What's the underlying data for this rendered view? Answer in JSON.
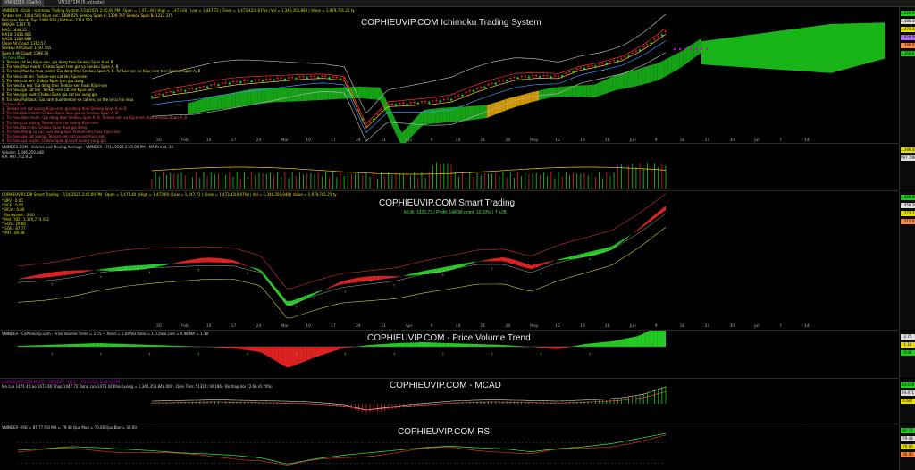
{
  "tabs": [
    "VNINDEX (Daily)",
    "VN30F1M (5 minute)"
  ],
  "panes": {
    "ichimoku": {
      "watermark": "COPHIEUVIP.COM Ichimoku Trading System",
      "header": "VNINDEX - Daily - Ichimoku Trading System 7/14/2025 2:45:00 PM : Open = 1,471.40 | High = 1,473.60 | Low = 1,447.72 | Close = 1,473.42(0.67%) | Vol = 1,346,350,848 | Value = 1,979,701.25 ty",
      "legend_lines": [
        "Tenkan sen: 1424.585   Kijun sen: 1389.025   Senkou Span A: 1309.787   Senkou Span B: 1212.375",
        "Bollinger Bands Top: 1480.818 | Bottom: 1314.593",
        "SMA20: 1397.71",
        "MA5: 1444.12",
        "MA10: 1430.402",
        "MA50: 1284.688",
        "Close All Cloud: 1310.57",
        "Senkou All Cloud: 1187.565",
        "Span B All Cloud: 1298.30",
        "Tin hieu Mua",
        "1. Tenkan cat len Kijun-sen, gia dong tren Senkou Span A va B",
        "2. Tin hieu Mua manh: Chikou Span tren gia va Senkou Span A, B",
        "3. Tin hieu Mua tu mua manh: Gia dong tren Senkou Span A, B. Tenkan-sen va Kijun-sen tren Senkou Span A, B",
        "4. Tin hieu cat len: Tenkan-sen cat len Kijun-sen",
        "5. Tin hieu cat len: Chikou Span tren gia dong",
        "6. Tin hieu tu ma: Gia dong tren Tenkan-sen hoac Kijun-sen",
        "7. Tin hieu gia cat len: Tenkan-sen cat len Kijun-sen",
        "8. Tin hieu gia vuot: Chikou Span gia cat len vung gia",
        "9. Tin hieu Pullback: Gia nam duoi tenkan-se cat len, co the la co hoi mua",
        "",
        "Tin hieu Ban",
        "1. Tenkan sen cat xuong Kijun-sen, gia dong duoi Senkou Span A va B",
        "2. Tin hieu Ban manh: Chikou Span duoi gia va Senkou Span A, B",
        "3. Tin hieu Ban manh: Gia dong duoi Senkou Span A, B. Tenkan-sen va Kijun-sen duoi Senkou Span A, B",
        "4. Tin hieu cat xuong: Tenkan-sen cat xuong Kijun-sen",
        "5. Tin hieu Ban nhe: Chikou Span duoi gia dong",
        "6. Tin hieu Mang cu xuc: Gia dong duoi Tenkan-sen hoac Kijun-sen",
        "7. Tin hieu gia cat xuong: Tenkan-sen cat xuong Kijun-sen",
        "8. Tin hieu gia xuyen: Chikou Span gia cat xuong vung gia",
        "9. Tin hieu Pullback nguoc: Gia nam tren tenkan-se cat xuong, co the la co hoi ban"
      ],
      "axis_tags": [
        "1,520.56",
        "1,485.15",
        "1,473.42",
        "1,424.58",
        "1,389.02",
        "1,354.67"
      ]
    },
    "volume": {
      "header": "VNINDEX.COM - Volume and Moving Average - VNINDEX - 7/14/2025 2:45:00 PM | MA Period: 20",
      "legend_lines": [
        "Volume: 1,346,350,848",
        "MA: 997,742,912"
      ],
      "axis_tags": [
        "1,346.35M",
        "997.74M"
      ]
    },
    "smart": {
      "watermark": "COPHIEUVIP.COM Smart Trading",
      "sub": "MUA: 1325.73 | Profit: 144.96 point: 10.93% | T +28",
      "header": "COPHIEUVIP.COM Smart Trading - 7/14/2025 2:45:00 PM : Open = 1,471.40 | High = 1,473.60 | Low = 1,447.72 | Close = 1,473.42(0.67%) | Vol = 1,346,350,848 | Value = 1,979,701.25 ty",
      "legend_lines": [
        "* BP2  : 0.00",
        "* BCE  : 0.00",
        "* BCm  : 0.00",
        "* RockValue : 0.00",
        "* Mid TRD : 1,370,774.432",
        "* SOS  : 29.66",
        "* SOE  : 87.77",
        "* MFI  : 80.08"
      ],
      "axis_tags": [
        "1,480.00",
        "1,458.20",
        "1,373.33",
        "1,315.67"
      ]
    },
    "pvt": {
      "watermark": "COPHIEUVIP.COM - Price Volume Trend",
      "header": "VNINDEX - CoPhieuVip.com - Price Volume Trend = 2.75  -- Trend = 1.09   Vol Ratio = 1.0    Zero Line = 0.98  MA = 1.18",
      "axis_tags": [
        "2.75",
        "1.18",
        "0.98"
      ]
    },
    "macd": {
      "watermark": "COPHIEUVIP.COM - MCAD",
      "header": "COPHIEUVIP.COM MACD - VNINDEX - Daily - 7/14/2025 2:45:00 PM",
      "line2": "Mo cua 1471.4  Cao 1473.60  Thap 1447.72  Dong cua 1473.42  Khoi Luong = 1,346,350,848.000 - Dien Tien: 51310 / 80186 - Bo thap doi 72.66 (0.70%)",
      "axis_tags": [
        "34.078",
        "29.471",
        "4.607"
      ]
    },
    "rsi": {
      "watermark": "COPHIEUVIP.COM RSI",
      "header": "VNINDEX - RSI = 87.77  RSI MA = 79.48  Qua Mua = 70.00  Qua Ban = 30.00",
      "axis_tags": [
        "87.77",
        "79.48",
        "70.00",
        "30.00"
      ]
    }
  },
  "date_labels": [
    "20",
    "Feb",
    "10",
    "17",
    "24",
    "Mar",
    "10",
    "17",
    "24",
    "31",
    "Apr",
    "9",
    "14",
    "21",
    "28",
    "May",
    "12",
    "19",
    "26",
    "Jun",
    "9",
    "16",
    "23",
    "30",
    "Jul",
    "7",
    "14"
  ],
  "colors": {
    "background": "#000000",
    "cloud_bull": "#18b418",
    "cloud_bear": "#e8a800",
    "up": "#22cc22",
    "down": "#dd2222",
    "accent_magenta": "#d000d0",
    "tag_yellow": "#e8e000",
    "tag_green": "#22cc22",
    "tag_white": "#dddddd"
  },
  "chart_data": [
    {
      "type": "line",
      "name": "ichimoku-close",
      "x": [
        "2025-01-20",
        "2025-02-03",
        "2025-02-10",
        "2025-02-17",
        "2025-02-24",
        "2025-03-03",
        "2025-03-10",
        "2025-03-17",
        "2025-03-24",
        "2025-03-31",
        "2025-04-09",
        "2025-04-14",
        "2025-04-21",
        "2025-04-28",
        "2025-05-05",
        "2025-05-12",
        "2025-05-19",
        "2025-05-26",
        "2025-06-02",
        "2025-06-09",
        "2025-06-16",
        "2025-06-23",
        "2025-06-30",
        "2025-07-07",
        "2025-07-14"
      ],
      "y": [
        1250,
        1265,
        1275,
        1290,
        1300,
        1305,
        1310,
        1315,
        1318,
        1310,
        1145,
        1220,
        1225,
        1230,
        1240,
        1270,
        1295,
        1315,
        1320,
        1318,
        1345,
        1360,
        1380,
        1420,
        1473
      ]
    },
    {
      "type": "area",
      "name": "smart-trading-oscillator",
      "x": [
        "2025-01-20",
        "2025-02-03",
        "2025-02-10",
        "2025-02-17",
        "2025-02-24",
        "2025-03-03",
        "2025-03-10",
        "2025-03-17",
        "2025-03-24",
        "2025-03-31",
        "2025-04-09",
        "2025-04-14",
        "2025-04-21",
        "2025-04-28",
        "2025-05-05",
        "2025-05-12",
        "2025-05-19",
        "2025-05-26",
        "2025-06-02",
        "2025-06-09",
        "2025-06-16",
        "2025-06-23",
        "2025-06-30",
        "2025-07-07",
        "2025-07-14"
      ],
      "y": [
        1270,
        1275,
        1285,
        1300,
        1310,
        1315,
        1318,
        1322,
        1320,
        1300,
        1200,
        1230,
        1255,
        1265,
        1275,
        1295,
        1310,
        1325,
        1325,
        1300,
        1330,
        1350,
        1370,
        1420,
        1480
      ]
    },
    {
      "type": "bar",
      "name": "pvt-histogram",
      "values": [
        0.1,
        0.2,
        0.3,
        0.4,
        0.3,
        0.2,
        0.1,
        0.0,
        -0.2,
        -0.6,
        -2.4,
        -1.2,
        -0.2,
        0.2,
        0.4,
        0.5,
        0.4,
        0.3,
        0.2,
        0.0,
        -0.3,
        0.3,
        0.6,
        1.2,
        2.75
      ]
    },
    {
      "type": "bar",
      "name": "macd-histogram",
      "values": [
        2,
        3,
        4,
        5,
        4,
        3,
        2,
        1,
        -2,
        -6,
        -18,
        -12,
        -6,
        -2,
        2,
        4,
        5,
        4,
        3,
        2,
        4,
        6,
        10,
        18,
        34
      ]
    },
    {
      "type": "line",
      "name": "rsi",
      "values": [
        55,
        58,
        62,
        60,
        57,
        54,
        50,
        48,
        45,
        40,
        28,
        38,
        45,
        50,
        55,
        60,
        63,
        60,
        58,
        52,
        58,
        62,
        68,
        78,
        87.77
      ]
    }
  ]
}
